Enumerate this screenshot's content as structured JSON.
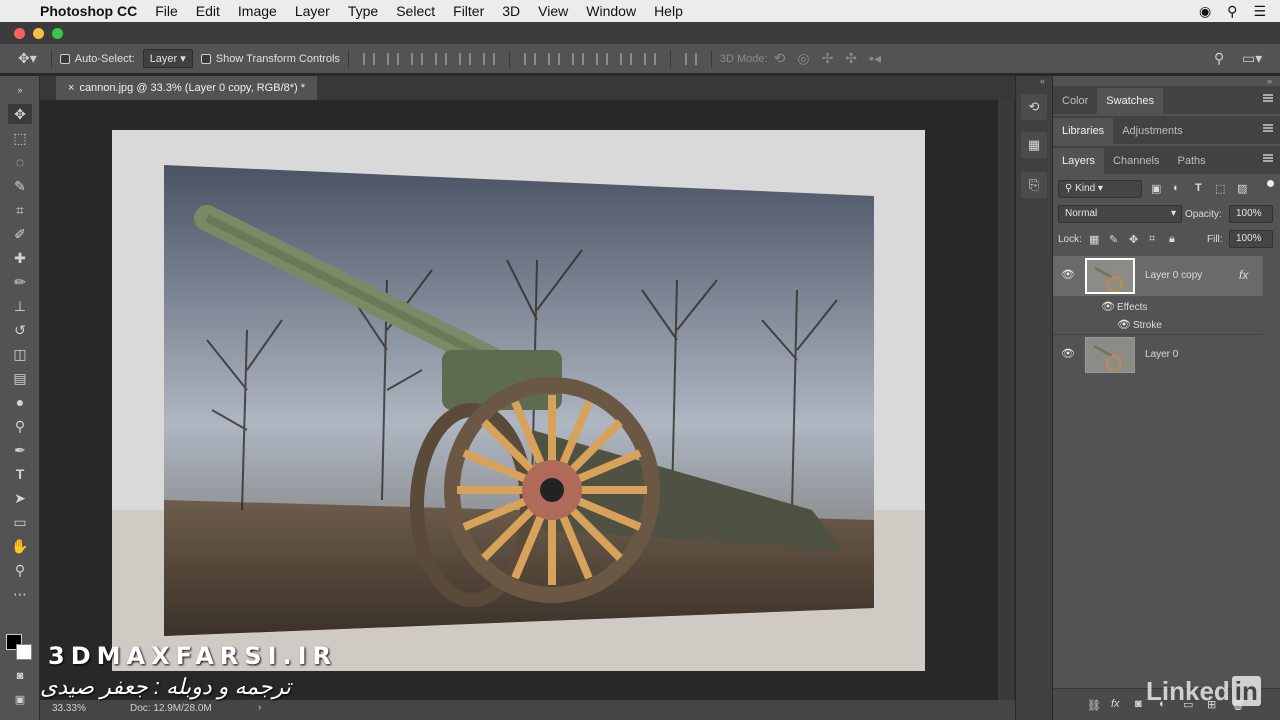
{
  "menubar": {
    "app_name": "Photoshop CC",
    "items": [
      "File",
      "Edit",
      "Image",
      "Layer",
      "Type",
      "Select",
      "Filter",
      "3D",
      "View",
      "Window",
      "Help"
    ]
  },
  "options_bar": {
    "auto_select_label": "Auto-Select:",
    "auto_select_value": "Layer",
    "show_transform_label": "Show Transform Controls",
    "mode_3d_label": "3D Mode:"
  },
  "document": {
    "tab_title": "cannon.jpg @ 33.3% (Layer 0 copy, RGB/8*) *"
  },
  "status": {
    "zoom": "33.33%",
    "doc_info": "Doc: 12.9M/28.0M"
  },
  "panels": {
    "top_tabs": [
      "Color",
      "Swatches"
    ],
    "mid_tabs": [
      "Libraries",
      "Adjustments"
    ],
    "layer_tabs": [
      "Layers",
      "Channels",
      "Paths"
    ],
    "kind_label": "Kind",
    "blend_mode": "Normal",
    "opacity_label": "Opacity:",
    "opacity_value": "100%",
    "lock_label": "Lock:",
    "fill_label": "Fill:",
    "fill_value": "100%",
    "layers": [
      {
        "name": "Layer 0 copy",
        "has_fx": true,
        "fx_label": "fx"
      },
      {
        "name": "Layer 0",
        "has_fx": false
      }
    ],
    "effects_label": "Effects",
    "stroke_label": "Stroke"
  },
  "watermarks": {
    "site": "3DMAXFARSI.IR",
    "farsi_credit": "ترجمه و دوبله : جعفر صیدی",
    "brand": "Linked",
    "brand_box": "in"
  },
  "colors": {
    "panel_bg": "#535353",
    "canvas_bg": "#282828",
    "selected_layer": "#6a6a6a"
  }
}
